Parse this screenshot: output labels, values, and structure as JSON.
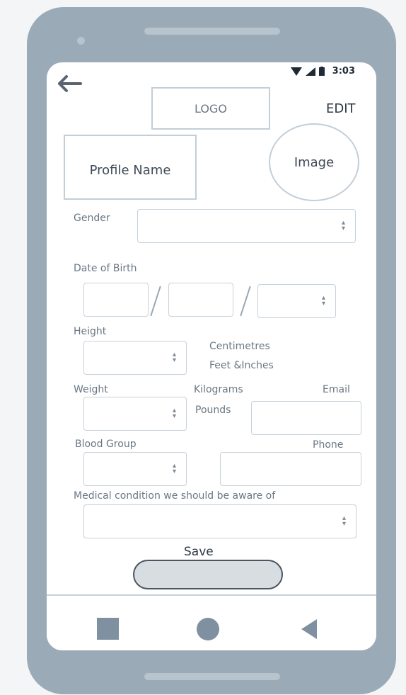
{
  "status_bar": {
    "time": "3:03"
  },
  "header": {
    "logo": "LOGO",
    "edit": "EDIT"
  },
  "profile": {
    "name": "Profile Name",
    "image": "Image"
  },
  "form": {
    "gender_label": "Gender",
    "dob_label": "Date of Birth",
    "dob_separator": "/",
    "height_label": "Height",
    "height_units": [
      "Centimetres",
      "Feet &Inches"
    ],
    "weight_label": "Weight",
    "weight_units": [
      "Kilograms",
      "Pounds"
    ],
    "email_label": "Email",
    "blood_group_label": "Blood Group",
    "phone_label": "Phone",
    "medical_label": "Medical condition we should be aware of",
    "save_label": "Save"
  },
  "colors": {
    "phone_body": "#9aaab7",
    "border": "#c2ced8",
    "text": "#5e6b78",
    "nav_icons": "#7f91a1"
  },
  "icons": [
    "back-arrow-icon",
    "wifi-icon",
    "signal-icon",
    "battery-icon",
    "select-arrow-icon",
    "square-icon",
    "circle-icon",
    "back-triangle-icon"
  ]
}
